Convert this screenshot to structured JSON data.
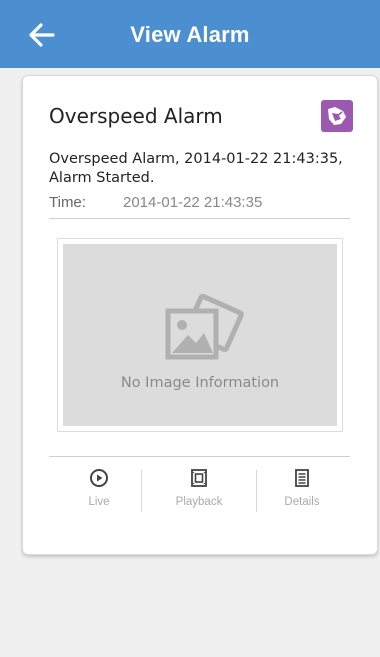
{
  "header": {
    "title": "View Alarm",
    "back_icon": "back-arrow-icon",
    "background": "#4c8fd0"
  },
  "alarm": {
    "title": "Overspeed Alarm",
    "type_icon": "overspeed-alarm-icon",
    "icon_color": "#9b5ab0",
    "description": "Overspeed Alarm, 2014-01-22 21:43:35, Alarm Started.",
    "time_label": "Time:",
    "time_value": "2014-01-22 21:43:35"
  },
  "image": {
    "placeholder_icon": "image-placeholder-icon",
    "placeholder_text": "No Image Information"
  },
  "actions": [
    {
      "label": "Live",
      "icon": "play-circle-icon"
    },
    {
      "label": "Playback",
      "icon": "film-icon"
    },
    {
      "label": "Details",
      "icon": "document-icon"
    }
  ]
}
